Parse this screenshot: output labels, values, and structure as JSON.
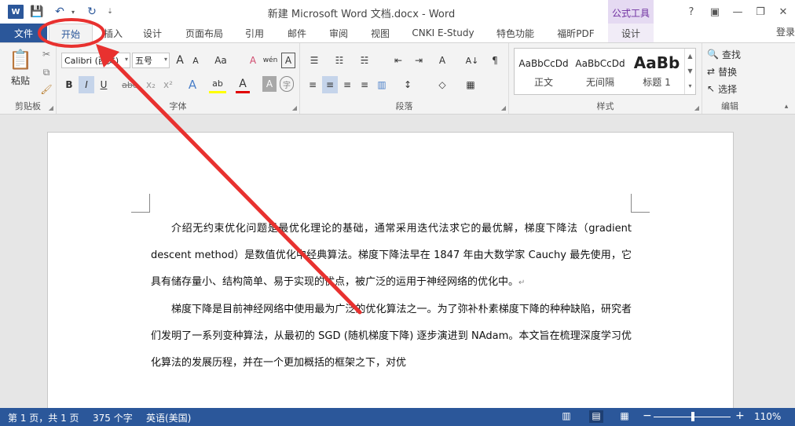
{
  "titlebar": {
    "app_logo": "W",
    "title": "新建 Microsoft Word 文档.docx - Word",
    "context_tab_group": "公式工具",
    "help": "?",
    "ribbon_display": "▣",
    "minimize": "—",
    "restore": "❐",
    "close": "✕"
  },
  "quick_access": {
    "save_icon": "💾",
    "undo_icon": "↶",
    "undo_dropdown": "▾",
    "redo_icon": "↻",
    "customize": "⇣"
  },
  "tabs": {
    "file": "文件",
    "home": "开始",
    "insert": "插入",
    "design": "设计",
    "layout": "页面布局",
    "references": "引用",
    "mailings": "邮件",
    "review": "审阅",
    "view": "视图",
    "cnki": "CNKI E-Study",
    "special": "特色功能",
    "foxit": "福昕PDF",
    "equation_design": "设计",
    "login": "登录"
  },
  "ribbon": {
    "clipboard": {
      "label": "剪贴板",
      "paste": "粘贴",
      "paste_icon": "📋",
      "cut": "✂",
      "copy": "⧉",
      "format_painter": "🖌"
    },
    "font": {
      "label": "字体",
      "font_name": "Calibri (西文)",
      "font_size": "五号",
      "grow": "A",
      "shrink": "A",
      "change_case": "Aa",
      "clear": "A",
      "phonetic": "wén",
      "char_border": "A",
      "bold": "B",
      "italic": "I",
      "underline": "U",
      "strike": "abc",
      "subscript": "x₂",
      "superscript": "x²",
      "effects": "A",
      "highlight": "ab",
      "font_color": "A",
      "char_shading": "A",
      "enclose": "字"
    },
    "paragraph": {
      "label": "段落",
      "bullets": "☰",
      "numbering": "☷",
      "multilevel": "☵",
      "decrease_indent": "⇤",
      "increase_indent": "⇥",
      "asian_layout": "A",
      "sort": "A↓",
      "show_marks": "¶",
      "align_left": "≡",
      "center": "≡",
      "align_right": "≡",
      "justify": "≡",
      "distributed": "▥",
      "line_spacing": "↕",
      "shading": "◇",
      "borders": "▦"
    },
    "styles": {
      "label": "样式",
      "items": [
        {
          "sample": "AaBbCcDd",
          "name": "正文"
        },
        {
          "sample": "AaBbCcDd",
          "name": "无间隔"
        },
        {
          "sample": "AaBb",
          "name": "标题 1"
        }
      ]
    },
    "editing": {
      "label": "编辑",
      "find": "查找",
      "replace": "替换",
      "select": "选择"
    }
  },
  "document": {
    "paragraphs": [
      "介绍无约束优化问题是最优化理论的基础，通常采用迭代法求它的最优解，梯度下降法（gradient descent method）是数值优化中经典算法。梯度下降法早在 1847 年由大数学家 Cauchy 最先使用，它具有储存量小、结构简单、易于实现的优点，被广泛的运用于神经网络的优化中。",
      "梯度下降是目前神经网络中使用最为广泛的优化算法之一。为了弥补朴素梯度下降的种种缺陷，研究者们发明了一系列变种算法，从最初的 SGD (随机梯度下降) 逐步演进到 NAdam。本文旨在梳理深度学习优化算法的发展历程，并在一个更加概括的框架之下，对优"
    ],
    "para_mark": "↵"
  },
  "status": {
    "page": "第 1 页，共 1 页",
    "words": "375 个字",
    "language": "英语(美国)",
    "zoom_minus": "−",
    "zoom_plus": "+",
    "zoom": "110%"
  },
  "colors": {
    "word_blue": "#2b579a",
    "annotation_red": "#e8312f"
  }
}
